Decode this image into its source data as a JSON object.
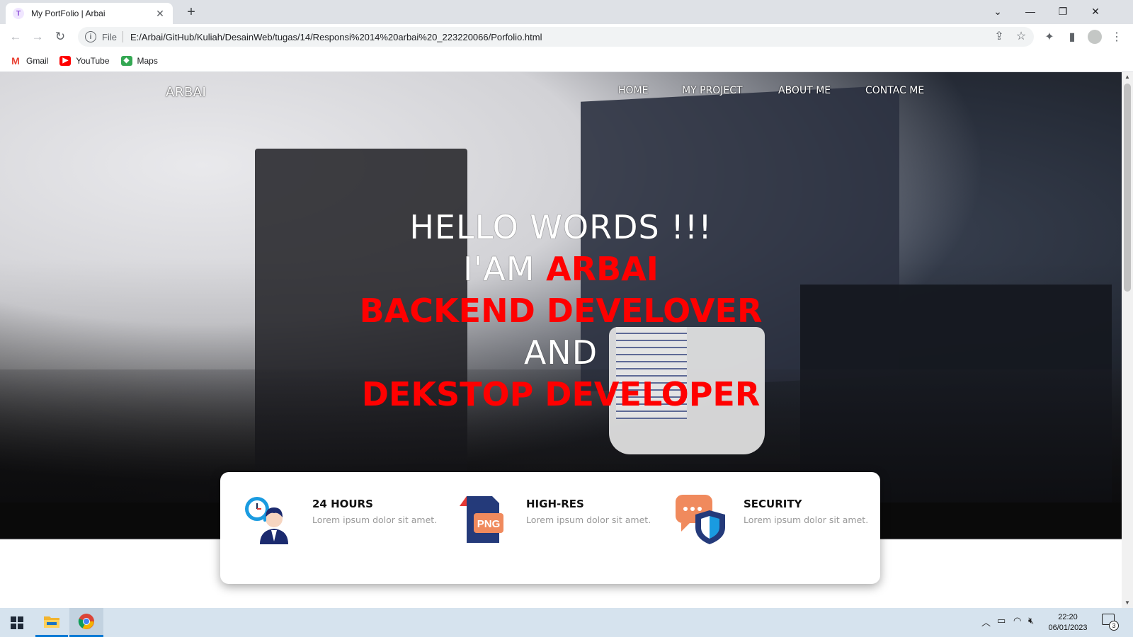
{
  "browser": {
    "tab_title": "My PortFolio | Arbai",
    "tab_favicon_letter": "T",
    "new_tab_symbol": "+",
    "address_prefix": "File",
    "url": "E:/Arbai/GitHub/Kuliah/DesainWeb/tugas/14/Responsi%2014%20arbai%20_223220066/Porfolio.html",
    "bookmarks": [
      {
        "label": "Gmail",
        "icon": "gmail-icon",
        "color": "#ea4335"
      },
      {
        "label": "YouTube",
        "icon": "youtube-icon",
        "color": "#ff0000"
      },
      {
        "label": "Maps",
        "icon": "maps-icon",
        "color": "#34a853"
      }
    ]
  },
  "site": {
    "brand": "ARBAI",
    "nav": [
      "HOME",
      "MY PROJECT",
      "ABOUT ME",
      "CONTAC ME"
    ],
    "headline": {
      "line1": "HELLO WORDS !!!",
      "line2_prefix": "I'AM ",
      "line2_name": "ARBAI",
      "line3": "BACKEND DEVELOVER",
      "line4": "AND",
      "line5": "DEKSTOP DEVELOPER"
    },
    "accent_color": "#ff0000",
    "features": [
      {
        "title": "24 HOURS",
        "desc": "Lorem ipsum dolor sit amet.",
        "icon": "support-agent-clock-icon"
      },
      {
        "title": "HIGH-RES",
        "desc": "Lorem ipsum dolor sit amet.",
        "icon": "png-file-icon",
        "badge": "PNG"
      },
      {
        "title": "SECURITY",
        "desc": "Lorem ipsum dolor sit amet.",
        "icon": "chat-shield-icon"
      }
    ]
  },
  "taskbar": {
    "time": "22:20",
    "date": "06/01/2023",
    "notification_count": "3"
  }
}
